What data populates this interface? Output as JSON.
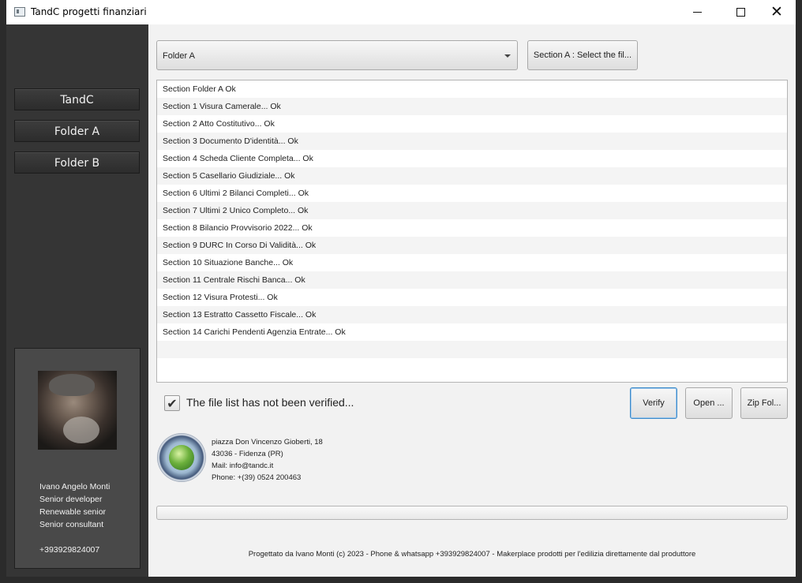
{
  "window": {
    "title": "TandC progetti finanziari"
  },
  "sidebar": {
    "buttons": [
      {
        "label": "TandC"
      },
      {
        "label": "Folder A"
      },
      {
        "label": "Folder B"
      }
    ],
    "profile": {
      "name": "Ivano Angelo Monti",
      "role1": "Senior developer",
      "role2": "Renewable senior",
      "role3": "Senior consultant",
      "phone": "+393929824007"
    }
  },
  "main": {
    "folder_select": {
      "selected": "Folder A"
    },
    "section_button": "Section A : Select the fil...",
    "file_list": [
      "Section Folder A Ok",
      "Section 1 Visura Camerale...  Ok",
      "Section 2 Atto Costitutivo...  Ok",
      "Section 3 Documento D'identità...  Ok",
      "Section 4 Scheda Cliente Completa...  Ok",
      "Section 5 Casellario Giudiziale...  Ok",
      "Section 6 Ultimi 2 Bilanci Completi...  Ok",
      "Section 7 Ultimi 2 Unico Completo...  Ok",
      "Section 8 Bilancio Provvisorio 2022...  Ok",
      "Section 9 DURC In Corso Di Validità...  Ok",
      "Section 10 Situazione Banche...  Ok",
      "Section 11 Centrale Rischi Banca...  Ok",
      "Section 12 Visura Protesti...  Ok",
      "Section 13 Estratto Cassetto Fiscale...  Ok",
      "Section 14 Carichi Pendenti Agenzia Entrate...  Ok",
      "",
      ""
    ],
    "verified_checkbox": {
      "label": "The file list has not been verified...",
      "checked": true
    },
    "buttons": {
      "verify": "Verify",
      "open": "Open ...",
      "zip": "Zip Fol..."
    },
    "address": {
      "line1": "piazza Don Vincenzo Gioberti, 18",
      "line2": "43036 - Fidenza (PR)",
      "line3": "Mail: info@tandc.it",
      "line4": "Phone: +(39) 0524 200463"
    },
    "progress": 0,
    "footer": "Progettato da Ivano Monti (c) 2023 - Phone & whatsapp +393929824007 - Makerplace prodotti per l'edilizia direttamente dal produttore"
  },
  "colors": {
    "sidebar_bg": "#353535",
    "content_bg": "#f2f2f2",
    "focus_accent": "#3c8ac9"
  },
  "icons": [
    "app-icon",
    "minimize-icon",
    "maximize-icon",
    "close-icon",
    "dropdown-arrow-icon",
    "check-icon",
    "globe-logo-icon"
  ]
}
